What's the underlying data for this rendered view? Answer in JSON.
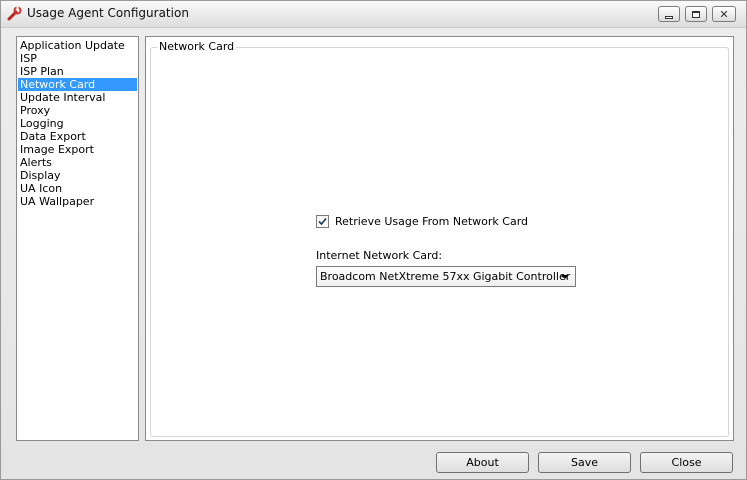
{
  "window": {
    "title": "Usage Agent Configuration",
    "icon": "wrench-icon"
  },
  "sidebar": {
    "items": [
      {
        "label": "Application Update",
        "selected": false
      },
      {
        "label": "ISP",
        "selected": false
      },
      {
        "label": "ISP Plan",
        "selected": false
      },
      {
        "label": "Network Card",
        "selected": true
      },
      {
        "label": "Update Interval",
        "selected": false
      },
      {
        "label": "Proxy",
        "selected": false
      },
      {
        "label": "Logging",
        "selected": false
      },
      {
        "label": "Data Export",
        "selected": false
      },
      {
        "label": "Image Export",
        "selected": false
      },
      {
        "label": "Alerts",
        "selected": false
      },
      {
        "label": "Display",
        "selected": false
      },
      {
        "label": "UA Icon",
        "selected": false
      },
      {
        "label": "UA Wallpaper",
        "selected": false
      }
    ],
    "selection_color": "#3399ff"
  },
  "panel": {
    "group_title": "Network Card",
    "retrieve_checkbox": {
      "label": "Retrieve Usage From Network Card",
      "checked": true
    },
    "network_card_label": "Internet Network Card:",
    "network_card_value": "Broadcom NetXtreme 57xx Gigabit Controller"
  },
  "buttons": {
    "about": "About",
    "save": "Save",
    "close": "Close"
  }
}
